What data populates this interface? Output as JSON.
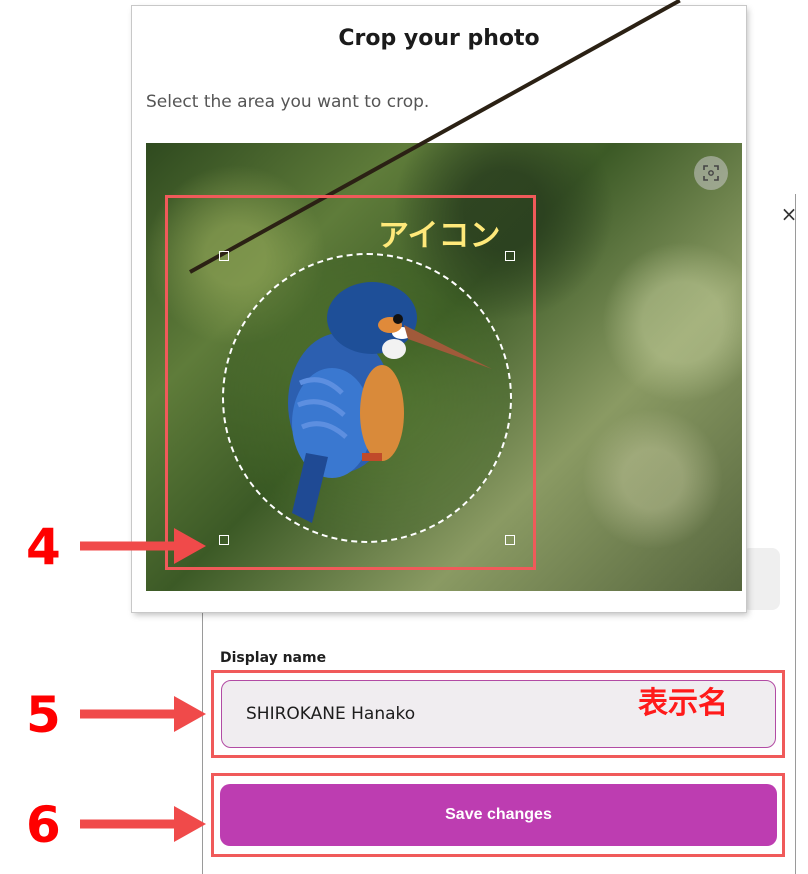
{
  "crop_dialog": {
    "title": "Crop your photo",
    "subtitle": "Select the area you want to crop."
  },
  "profile_panel": {
    "close_glyph": "×",
    "display_name_label": "Display name",
    "display_name_value": "SHIROKANE Hanako",
    "save_label": "Save changes"
  },
  "annotations": {
    "icon_label": "アイコン",
    "display_name_label": "表示名",
    "step_4": "4",
    "step_5": "5",
    "step_6": "6"
  },
  "icons": {
    "focus": "focus-frame-icon",
    "close": "close-icon"
  },
  "colors": {
    "accent": "#bd3db1",
    "annotation_red": "#f05a5a",
    "annotation_yellow": "#ffe97a"
  }
}
